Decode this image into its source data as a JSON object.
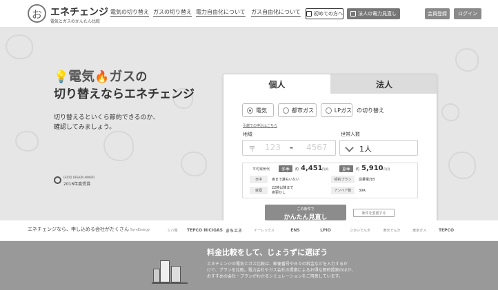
{
  "header": {
    "logo_title": "エネチェンジ",
    "logo_sub": "電気とガスのかんたん比較",
    "nav": [
      {
        "label": "電気の切り替え"
      },
      {
        "label": "ガスの切り替え"
      },
      {
        "label": "電力自由化について"
      },
      {
        "label": "ガス自由化について"
      }
    ],
    "first_time_label": "初めての方へ",
    "corporate_label": "法人の電力見直し",
    "register_label": "会員登録",
    "login_label": "ログイン"
  },
  "hero": {
    "electric": "電気",
    "gas": "ガス",
    "no": "の",
    "title_line2": "切り替えならエネチェンジ",
    "desc_line1": "切り替えるといくら節約できるのか、",
    "desc_line2": "確認してみましょう。",
    "award_top": "GOOD DESIGN AWARD",
    "award_main": "2016年度受賞"
  },
  "simulator": {
    "tab_personal": "個人",
    "tab_corporate": "法人",
    "options": [
      {
        "label": "電気",
        "selected": true
      },
      {
        "label": "都市ガス",
        "selected": false
      },
      {
        "label": "LPガス",
        "selected": false
      }
    ],
    "option_suffix": "の切り替え",
    "small_link": "引越での申込はこちら",
    "region_label": "地域",
    "household_label": "世帯人数",
    "zip_mark": "〒",
    "zip_first": "123",
    "zip_dash": "-",
    "zip_second": "4567",
    "household_value": "1人",
    "info": {
      "avg_label": "平均電気代",
      "winter_label": "冬季",
      "winter_approx": "約",
      "winter_price": "4,451",
      "winter_unit": "円/月",
      "summer_label": "夏季",
      "summer_approx": "約",
      "summer_price": "5,910",
      "summer_unit": "円/月",
      "day_label": "日中",
      "day_value": "夜まで誰もいない",
      "contract_label": "契約プラン",
      "contract_value": "従量電灯B",
      "bath_label": "就寝",
      "bath_value_line1": "22時以降まで",
      "bath_value_line2": "夜更かし",
      "ampere_label": "アンペア数",
      "ampere_value": "30A"
    },
    "submit_top": "この条件で",
    "submit_main": "かんたん見直し",
    "change_label": "条件を変更する"
  },
  "partners": {
    "text": "エネチェンジなら、申し込める会社がたくさん",
    "logos": [
      {
        "label": "SymEnergy"
      },
      {
        "label": "エバ電"
      },
      {
        "label": "TEPCO NICIGAS"
      },
      {
        "label": "まちエネ"
      },
      {
        "label": "イーレックス"
      },
      {
        "label": "ENS"
      },
      {
        "label": "LPIO"
      },
      {
        "label": "さかいでんき"
      },
      {
        "label": "楽天でんき"
      },
      {
        "label": "東京ガス"
      },
      {
        "label": "TEPCO"
      }
    ]
  },
  "band": {
    "title": "料金比較をして、じょうずに選ぼう",
    "line1": "エネチェンジの電気とガス比較は、郵便番号や日々の料金などを入力するだ",
    "line2": "けで、プランを比較。電力会社やガス会社の提案によるお得な節約提案のほか、",
    "line3": "おすすめの会社・プランがわかるシミュレーションをご用意しています。"
  }
}
